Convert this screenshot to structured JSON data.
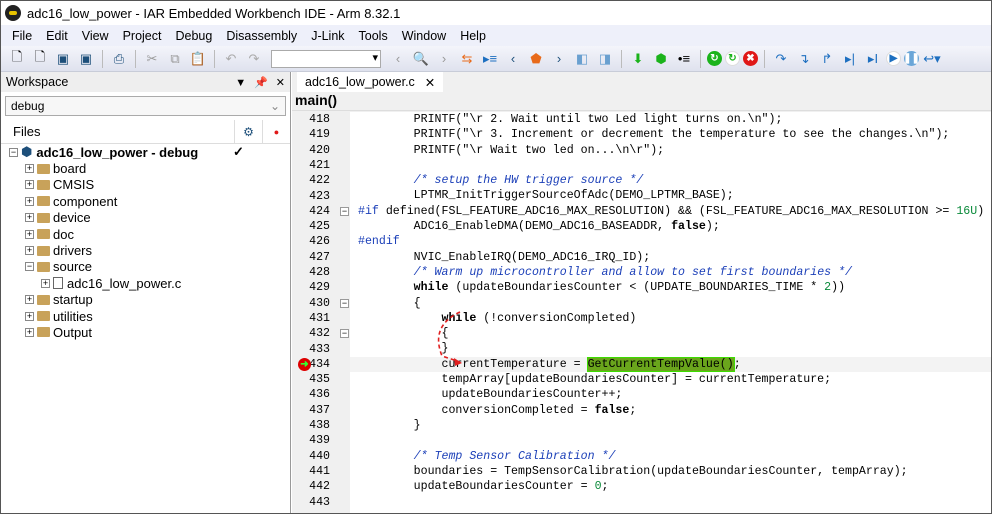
{
  "window": {
    "title": "adc16_low_power - IAR Embedded Workbench IDE - Arm 8.32.1"
  },
  "menu": [
    "File",
    "Edit",
    "View",
    "Project",
    "Debug",
    "Disassembly",
    "J-Link",
    "Tools",
    "Window",
    "Help"
  ],
  "workspace": {
    "title": "Workspace",
    "config": "debug",
    "files_label": "Files",
    "tree": [
      {
        "label": "adc16_low_power - debug",
        "depth": 0,
        "type": "project",
        "bold": true,
        "check": "✓"
      },
      {
        "label": "board",
        "depth": 1,
        "type": "folder"
      },
      {
        "label": "CMSIS",
        "depth": 1,
        "type": "folder"
      },
      {
        "label": "component",
        "depth": 1,
        "type": "folder"
      },
      {
        "label": "device",
        "depth": 1,
        "type": "folder"
      },
      {
        "label": "doc",
        "depth": 1,
        "type": "folder"
      },
      {
        "label": "drivers",
        "depth": 1,
        "type": "folder"
      },
      {
        "label": "source",
        "depth": 1,
        "type": "folder",
        "open": true
      },
      {
        "label": "adc16_low_power.c",
        "depth": 2,
        "type": "file"
      },
      {
        "label": "startup",
        "depth": 1,
        "type": "folder"
      },
      {
        "label": "utilities",
        "depth": 1,
        "type": "folder"
      },
      {
        "label": "Output",
        "depth": 1,
        "type": "folder"
      }
    ]
  },
  "editor": {
    "tab": "adc16_low_power.c",
    "function": "main()",
    "current_line": 434,
    "lines": [
      {
        "n": 418,
        "s": [
          [
            "n",
            "        PRINTF(\"\\r 2. Wait until two Led light turns on.\\n\");"
          ]
        ]
      },
      {
        "n": 419,
        "s": [
          [
            "n",
            "        PRINTF(\"\\r 3. Increment or decrement the temperature to see the changes.\\n\");"
          ]
        ]
      },
      {
        "n": 420,
        "s": [
          [
            "n",
            "        PRINTF(\"\\r Wait two led on...\\n\\r\");"
          ]
        ]
      },
      {
        "n": 421,
        "s": []
      },
      {
        "n": 422,
        "s": [
          [
            "n",
            "        "
          ],
          [
            "c",
            "/* setup the HW trigger source */"
          ]
        ]
      },
      {
        "n": 423,
        "s": [
          [
            "n",
            "        LPTMR_InitTriggerSourceOfAdc(DEMO_LPTMR_BASE);"
          ]
        ]
      },
      {
        "n": 424,
        "fold": "-",
        "s": [
          [
            "p",
            "#if"
          ],
          [
            "n",
            " defined(FSL_FEATURE_ADC16_MAX_RESOLUTION) && (FSL_FEATURE_ADC16_MAX_RESOLUTION >= "
          ],
          [
            "num",
            "16U"
          ],
          [
            "n",
            ")"
          ]
        ]
      },
      {
        "n": 425,
        "s": [
          [
            "n",
            "        ADC16_EnableDMA(DEMO_ADC16_BASEADDR, "
          ],
          [
            "k",
            "false"
          ],
          [
            "n",
            ");"
          ]
        ]
      },
      {
        "n": 426,
        "s": [
          [
            "p",
            "#endif"
          ]
        ]
      },
      {
        "n": 427,
        "s": [
          [
            "n",
            "        NVIC_EnableIRQ(DEMO_ADC16_IRQ_ID);"
          ]
        ]
      },
      {
        "n": 428,
        "s": [
          [
            "n",
            "        "
          ],
          [
            "c",
            "/* Warm up microcontroller and allow to set first boundaries */"
          ]
        ]
      },
      {
        "n": 429,
        "s": [
          [
            "n",
            "        "
          ],
          [
            "k",
            "while"
          ],
          [
            "n",
            " (updateBoundariesCounter < (UPDATE_BOUNDARIES_TIME * "
          ],
          [
            "num",
            "2"
          ],
          [
            "n",
            "))"
          ]
        ]
      },
      {
        "n": 430,
        "fold": "-",
        "s": [
          [
            "n",
            "        {"
          ]
        ]
      },
      {
        "n": 431,
        "s": [
          [
            "n",
            "            "
          ],
          [
            "k",
            "while"
          ],
          [
            "n",
            " (!conversionCompleted)"
          ]
        ]
      },
      {
        "n": 432,
        "fold": "-",
        "s": [
          [
            "n",
            "            {"
          ]
        ]
      },
      {
        "n": 433,
        "s": [
          [
            "n",
            "            }"
          ]
        ]
      },
      {
        "n": 434,
        "s": [
          [
            "n",
            "            currentTemperature = "
          ],
          [
            "hl",
            "GetCurrentTempValue()"
          ],
          [
            "n",
            ";"
          ]
        ]
      },
      {
        "n": 435,
        "s": [
          [
            "n",
            "            tempArray[updateBoundariesCounter] = currentTemperature;"
          ]
        ]
      },
      {
        "n": 436,
        "s": [
          [
            "n",
            "            updateBoundariesCounter++;"
          ]
        ]
      },
      {
        "n": 437,
        "s": [
          [
            "n",
            "            conversionCompleted = "
          ],
          [
            "k",
            "false"
          ],
          [
            "n",
            ";"
          ]
        ]
      },
      {
        "n": 438,
        "s": [
          [
            "n",
            "        }"
          ]
        ]
      },
      {
        "n": 439,
        "s": []
      },
      {
        "n": 440,
        "s": [
          [
            "n",
            "        "
          ],
          [
            "c",
            "/* Temp Sensor Calibration */"
          ]
        ]
      },
      {
        "n": 441,
        "s": [
          [
            "n",
            "        boundaries = TempSensorCalibration(updateBoundariesCounter, tempArray);"
          ]
        ]
      },
      {
        "n": 442,
        "s": [
          [
            "n",
            "        updateBoundariesCounter = "
          ],
          [
            "num",
            "0"
          ],
          [
            "n",
            ";"
          ]
        ]
      },
      {
        "n": 443,
        "s": []
      }
    ]
  },
  "colors": {
    "highlight": "#6aa51c",
    "arrow": "#e02020",
    "comment": "#1b3fb8"
  }
}
